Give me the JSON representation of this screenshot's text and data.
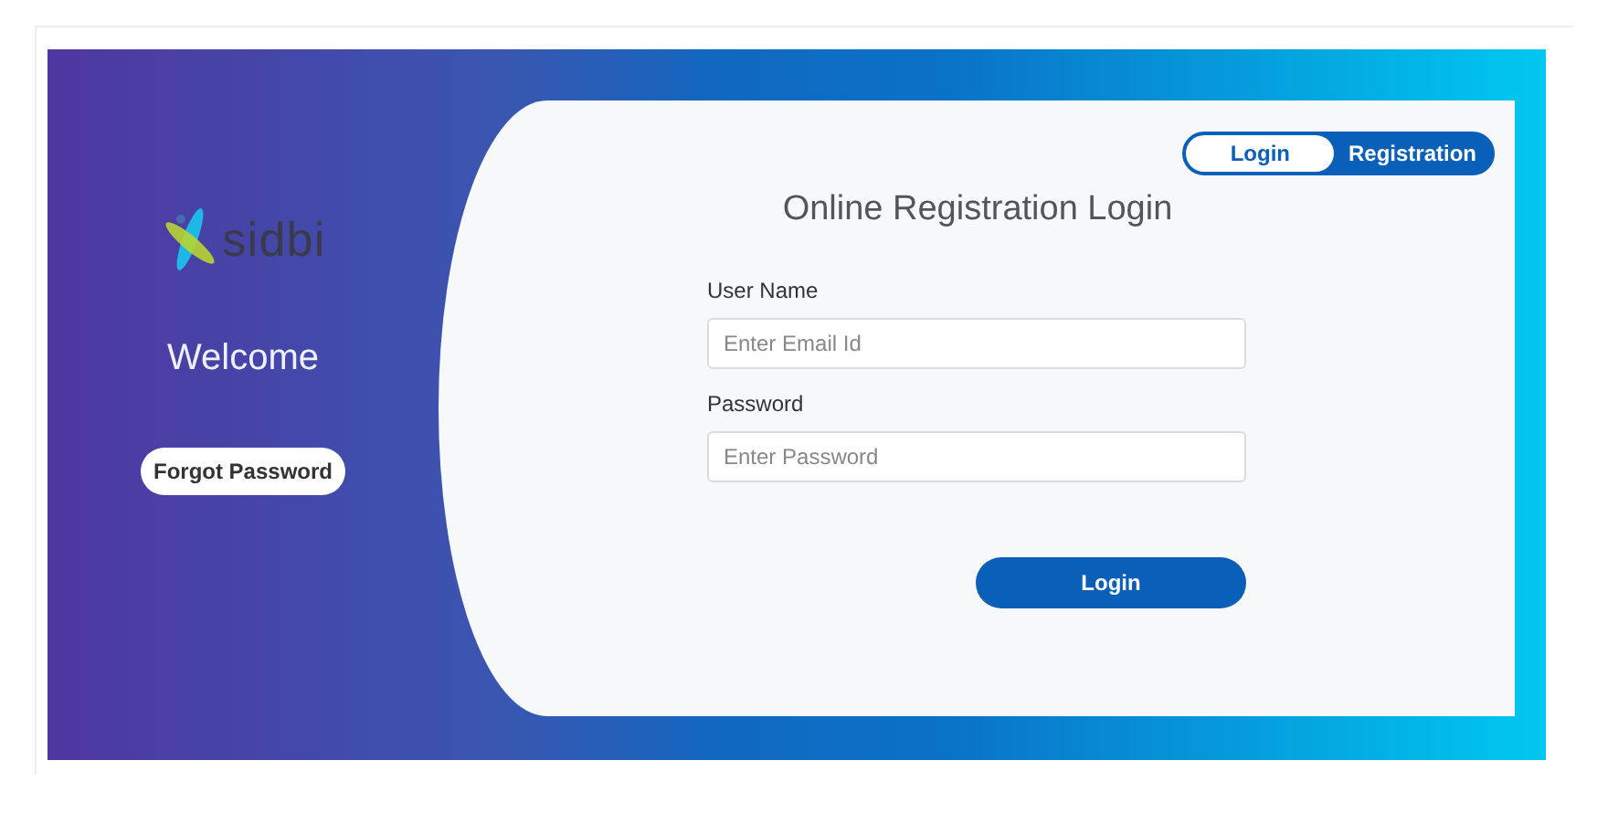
{
  "brand": {
    "logo_text": "sidbi"
  },
  "welcome": "Welcome",
  "forgot_button": "Forgot Password",
  "toggle": [
    {
      "label": "Login",
      "selected": true
    },
    {
      "label": "Registration",
      "selected": false
    }
  ],
  "title": "Online Registration Login",
  "fields": [
    {
      "label": "User Name",
      "placeholder": "Enter Email Id"
    },
    {
      "label": "Password",
      "placeholder": "Enter Password"
    }
  ],
  "submit": "Login"
}
